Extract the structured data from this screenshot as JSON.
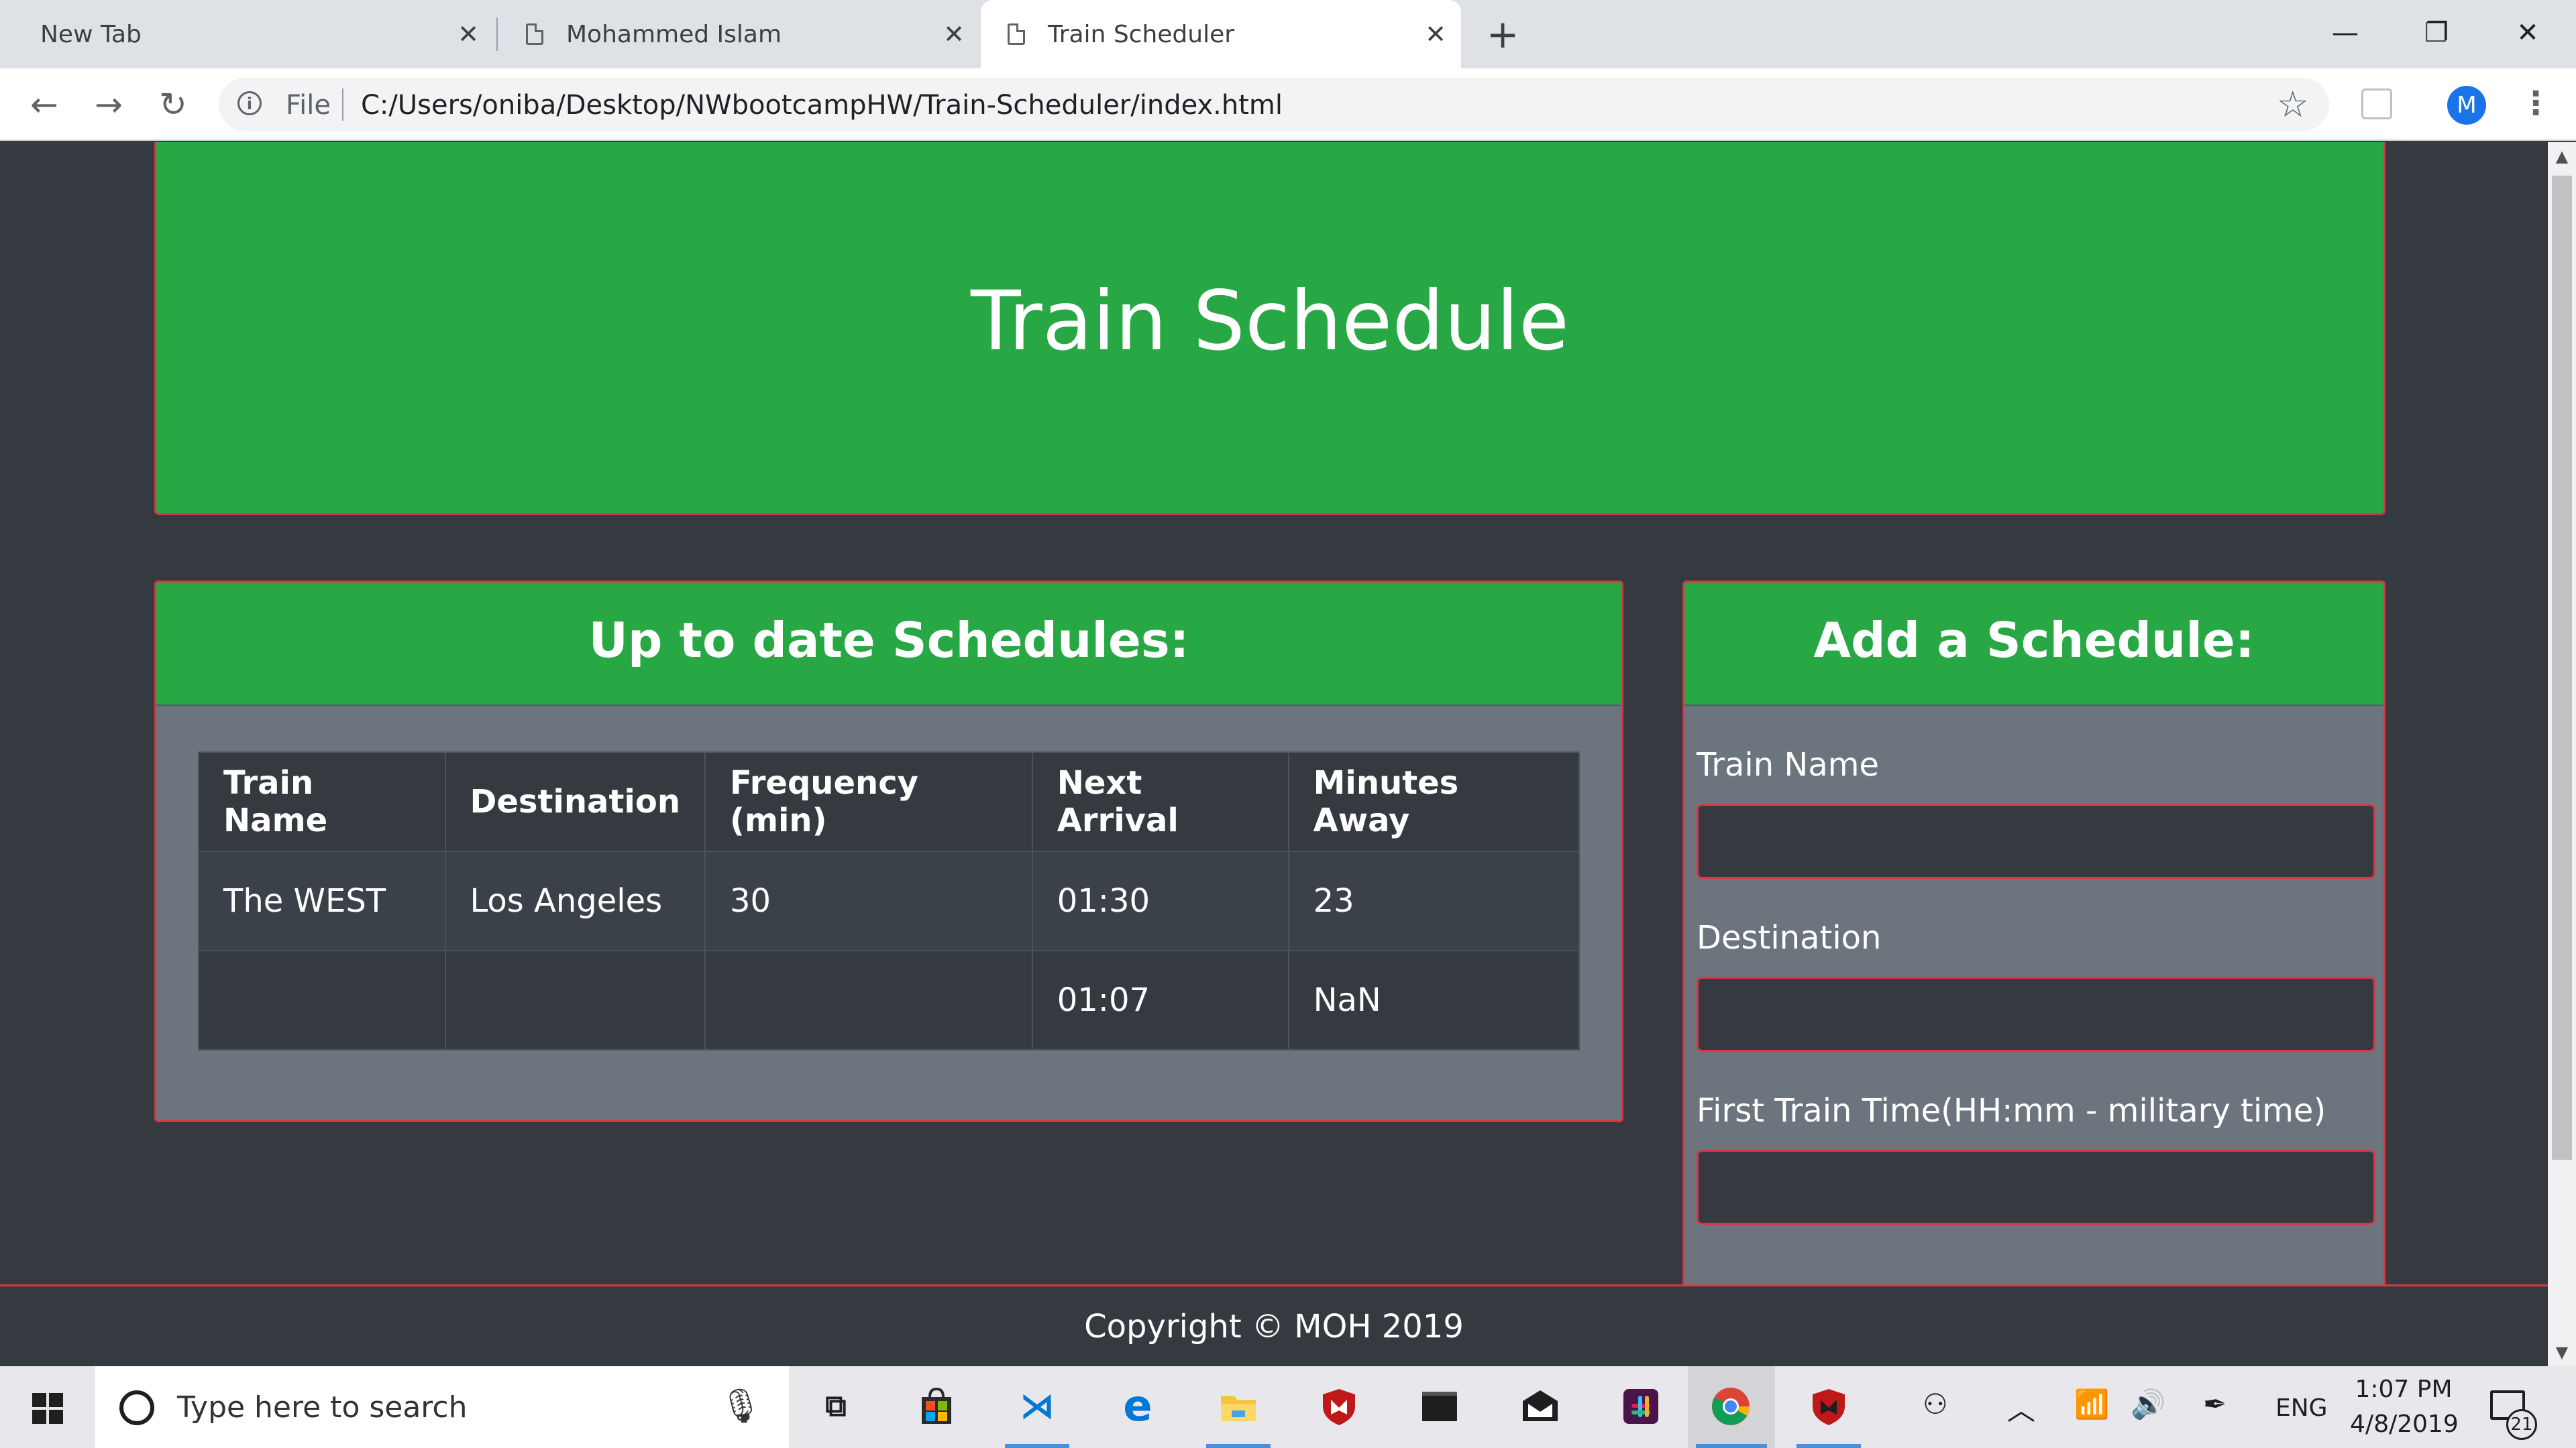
{
  "browser": {
    "tabs": [
      {
        "title": "New Tab"
      },
      {
        "title": "Mohammed Islam"
      },
      {
        "title": "Train Scheduler"
      }
    ],
    "close_glyph": "✕",
    "new_tab_glyph": "+",
    "window_controls": {
      "minimize": "—",
      "restore": "❐",
      "close": "✕"
    },
    "nav": {
      "back": "←",
      "forward": "→",
      "reload": "↻"
    },
    "address": {
      "scheme_label": "File",
      "url": "C:/Users/oniba/Desktop/NWbootcampHW/Train-Scheduler/index.html",
      "info_glyph": "i",
      "star_glyph": "☆"
    },
    "profile_initial": "M",
    "menu_glyph": "⋮"
  },
  "page": {
    "title": "Train Schedule",
    "schedules": {
      "heading": "Up to date Schedules:",
      "columns": [
        "Train Name",
        "Destination",
        "Frequency (min)",
        "Next Arrival",
        "Minutes Away"
      ],
      "rows": [
        [
          "The WEST",
          "Los Angeles",
          "30",
          "01:30",
          "23"
        ],
        [
          "",
          "",
          "",
          "01:07",
          "NaN"
        ]
      ]
    },
    "add_form": {
      "heading": "Add a Schedule:",
      "fields": [
        {
          "label": "Train Name"
        },
        {
          "label": "Destination"
        },
        {
          "label": "First Train Time(HH:mm - military time)"
        }
      ]
    },
    "footer": "Copyright © MOH 2019",
    "colors": {
      "header_green": "#28a745",
      "border_red": "#dc3545",
      "card_gray": "#6c757d",
      "dark": "#343a40"
    }
  },
  "taskbar": {
    "search_placeholder": "Type here to search",
    "apps": [
      "task-view",
      "store",
      "vscode",
      "edge",
      "file-explorer",
      "mcafee",
      "terminal",
      "mail",
      "slack",
      "chrome",
      "mcafee-security"
    ],
    "tray": {
      "language": "ENG"
    },
    "clock": {
      "time": "1:07 PM",
      "date": "4/8/2019"
    },
    "notifications": "21"
  }
}
